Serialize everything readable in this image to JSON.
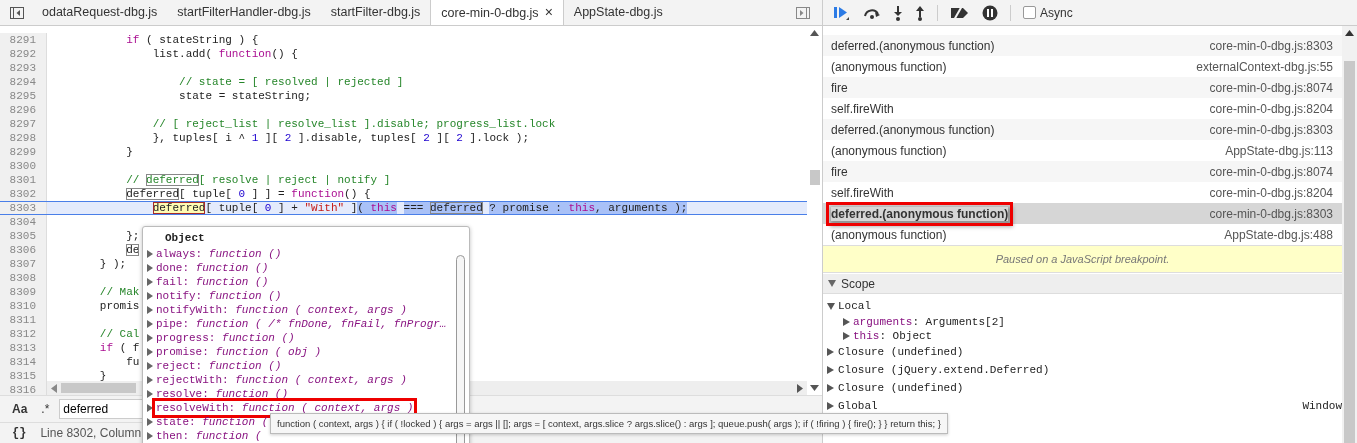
{
  "editor": {
    "tabs": [
      {
        "label": "odataRequest-dbg.js",
        "selected": false
      },
      {
        "label": "startFilterHandler-dbg.js",
        "selected": false
      },
      {
        "label": "startFilter-dbg.js",
        "selected": false
      },
      {
        "label": "core-min-0-dbg.js",
        "selected": true,
        "close": "×"
      },
      {
        "label": "AppState-dbg.js",
        "selected": false
      }
    ],
    "lines": [
      {
        "number": "8291",
        "current": false,
        "segments": [
          {
            "text": "            if",
            "kind": "keyword"
          },
          {
            "text": " ( stateString ) {",
            "kind": "plain"
          }
        ]
      },
      {
        "number": "8292",
        "current": false,
        "segments": [
          {
            "text": "                list.add( ",
            "kind": "plain"
          },
          {
            "text": "function",
            "kind": "keyword"
          },
          {
            "text": "() {",
            "kind": "plain"
          }
        ]
      },
      {
        "number": "8293",
        "current": false
      },
      {
        "number": "8294",
        "current": false,
        "segments": [
          {
            "text": "                    // state = [ resolved | rejected ]",
            "kind": "comment"
          }
        ]
      },
      {
        "number": "8295",
        "current": false,
        "segments": [
          {
            "text": "                    state = stateString;",
            "kind": "plain"
          }
        ]
      },
      {
        "number": "8296",
        "current": false
      },
      {
        "number": "8297",
        "current": false,
        "segments": [
          {
            "text": "                // [ reject_list | resolve_list ].disable; progress_list.lock",
            "kind": "comment"
          }
        ]
      },
      {
        "number": "8298",
        "current": false,
        "segments": [
          {
            "text": "                }, tuples[ i ^ ",
            "kind": "plain"
          },
          {
            "text": "1",
            "kind": "number"
          },
          {
            "text": " ][ ",
            "kind": "plain"
          },
          {
            "text": "2",
            "kind": "number"
          },
          {
            "text": " ].disable, tuples[ ",
            "kind": "plain"
          },
          {
            "text": "2",
            "kind": "number"
          },
          {
            "text": " ][ ",
            "kind": "plain"
          },
          {
            "text": "2",
            "kind": "number"
          },
          {
            "text": " ].lock );",
            "kind": "plain"
          }
        ]
      },
      {
        "number": "8299",
        "current": false,
        "segments": [
          {
            "text": "            }",
            "kind": "plain"
          }
        ]
      },
      {
        "number": "8300",
        "current": false
      },
      {
        "number": "8301",
        "current": false,
        "segments": [
          {
            "text": "            // ",
            "kind": "comment"
          },
          {
            "text": "deferred",
            "kind": "comment-match"
          },
          {
            "text": "[ resolve | reject | notify ]",
            "kind": "comment"
          }
        ]
      },
      {
        "number": "8302",
        "current": false,
        "segments": [
          {
            "text": "            deferred",
            "kind": "match"
          },
          {
            "text": "[ tuple[ ",
            "kind": "plain"
          },
          {
            "text": "0",
            "kind": "number"
          },
          {
            "text": " ] ] = ",
            "kind": "plain"
          },
          {
            "text": "function",
            "kind": "keyword"
          },
          {
            "text": "() {",
            "kind": "plain"
          }
        ]
      },
      {
        "number": "8303",
        "current": true,
        "segments": [
          {
            "text": "                deferred",
            "kind": "current-match"
          },
          {
            "text": "[ tuple[ ",
            "kind": "plain"
          },
          {
            "text": "0",
            "kind": "number"
          },
          {
            "text": " ] + ",
            "kind": "plain"
          },
          {
            "text": "\"With\"",
            "kind": "string"
          },
          {
            "text": " ]",
            "kind": "plain"
          },
          {
            "text": "( ",
            "kind": "selected"
          },
          {
            "text": "this",
            "kind": "selected-keyword"
          },
          {
            "text": " === ",
            "kind": "selected"
          },
          {
            "text": "deferred",
            "kind": "selected-match"
          },
          {
            "text": " ? promise : ",
            "kind": "selected"
          },
          {
            "text": "this",
            "kind": "selected-keyword"
          },
          {
            "text": ", arguments );",
            "kind": "selected"
          }
        ]
      },
      {
        "number": "8304",
        "current": false
      },
      {
        "number": "8305",
        "current": false,
        "segments": [
          {
            "text": "            };",
            "kind": "plain"
          }
        ]
      },
      {
        "number": "8306",
        "current": false,
        "segments": [
          {
            "text": "            de",
            "kind": "match"
          }
        ]
      },
      {
        "number": "8307",
        "current": false,
        "segments": [
          {
            "text": "        } );",
            "kind": "plain"
          }
        ]
      },
      {
        "number": "8308",
        "current": false
      },
      {
        "number": "8309",
        "current": false,
        "segments": [
          {
            "text": "        // Mak",
            "kind": "comment"
          }
        ]
      },
      {
        "number": "8310",
        "current": false,
        "segments": [
          {
            "text": "        promis",
            "kind": "plain"
          }
        ]
      },
      {
        "number": "8311",
        "current": false
      },
      {
        "number": "8312",
        "current": false,
        "segments": [
          {
            "text": "        // Cal",
            "kind": "comment"
          }
        ]
      },
      {
        "number": "8313",
        "current": false,
        "segments": [
          {
            "text": "        if",
            "kind": "keyword"
          },
          {
            "text": " ( f",
            "kind": "plain"
          }
        ]
      },
      {
        "number": "8314",
        "current": false,
        "segments": [
          {
            "text": "            fu",
            "kind": "plain"
          }
        ]
      },
      {
        "number": "8315",
        "current": false,
        "segments": [
          {
            "text": "        }",
            "kind": "plain"
          }
        ]
      },
      {
        "number": "8316",
        "current": false
      }
    ],
    "search": {
      "case_toggle": "Aa",
      "regex_toggle": ".*",
      "value": "deferred"
    },
    "status": {
      "braces": "{}",
      "position": "Line 8302, Column"
    },
    "popover": {
      "title": "Object",
      "properties": [
        {
          "name": "always:",
          "value": "function ()",
          "annotated": false
        },
        {
          "name": "done:",
          "value": "function ()",
          "annotated": false
        },
        {
          "name": "fail:",
          "value": "function ()",
          "annotated": false
        },
        {
          "name": "notify:",
          "value": "function ()",
          "annotated": false
        },
        {
          "name": "notifyWith:",
          "value": "function ( context, args )",
          "annotated": false
        },
        {
          "name": "pipe:",
          "value": "function ( /* fnDone, fnFail, fnProgr…",
          "annotated": false
        },
        {
          "name": "progress:",
          "value": "function ()",
          "annotated": false
        },
        {
          "name": "promise:",
          "value": "function ( obj )",
          "annotated": false
        },
        {
          "name": "reject:",
          "value": "function ()",
          "annotated": false
        },
        {
          "name": "rejectWith:",
          "value": "function ( context, args )",
          "annotated": false
        },
        {
          "name": "resolve:",
          "value": "function ()",
          "annotated": false
        },
        {
          "name": "resolveWith:",
          "value": "function ( context, args )",
          "annotated": true
        },
        {
          "name": "state:",
          "value": "function (",
          "annotated": false
        },
        {
          "name": "then:",
          "value": "function (",
          "annotated": false
        }
      ]
    },
    "tooltip": "function ( context, args ) { if ( !locked ) { args = args || []; args = [ context, args.slice ? args.slice() : args ]; queue.push( args ); if ( !firing ) { fire(); } } return this; }"
  },
  "debugger": {
    "async": {
      "label": "Async",
      "checked": false
    },
    "call_stack": [
      {
        "function": "deferred.(anonymous function)",
        "location": "core-min-0-dbg.js:8303",
        "selected": false,
        "annotated": false
      },
      {
        "function": "(anonymous function)",
        "location": "externalContext-dbg.js:55",
        "selected": false,
        "annotated": false
      },
      {
        "function": "fire",
        "location": "core-min-0-dbg.js:8074",
        "selected": false,
        "annotated": false
      },
      {
        "function": "self.fireWith",
        "location": "core-min-0-dbg.js:8204",
        "selected": false,
        "annotated": false
      },
      {
        "function": "deferred.(anonymous function)",
        "location": "core-min-0-dbg.js:8303",
        "selected": false,
        "annotated": false
      },
      {
        "function": "(anonymous function)",
        "location": "AppState-dbg.js:113",
        "selected": false,
        "annotated": false
      },
      {
        "function": "fire",
        "location": "core-min-0-dbg.js:8074",
        "selected": false,
        "annotated": false
      },
      {
        "function": "self.fireWith",
        "location": "core-min-0-dbg.js:8204",
        "selected": false,
        "annotated": false
      },
      {
        "function": "deferred.(anonymous function)",
        "location": "core-min-0-dbg.js:8303",
        "selected": true,
        "annotated": true
      },
      {
        "function": "(anonymous function)",
        "location": "AppState-dbg.js:488",
        "selected": false,
        "annotated": false
      }
    ],
    "paused_message": "Paused on a JavaScript breakpoint.",
    "scope": {
      "title": "Scope",
      "expanded": true,
      "items": [
        {
          "label": "Local",
          "expanded": true,
          "children": [
            {
              "name": "arguments",
              "value": ": Arguments[2]",
              "expanded": false
            },
            {
              "name": "this",
              "value": ": Object",
              "expanded": false
            }
          ]
        },
        {
          "label": "Closure (undefined)",
          "expanded": false
        },
        {
          "label": "Closure (jQuery.extend.Deferred)",
          "expanded": false
        },
        {
          "label": "Closure (undefined)",
          "expanded": false
        },
        {
          "label": "Global",
          "value": "Window",
          "expanded": false
        }
      ]
    }
  }
}
